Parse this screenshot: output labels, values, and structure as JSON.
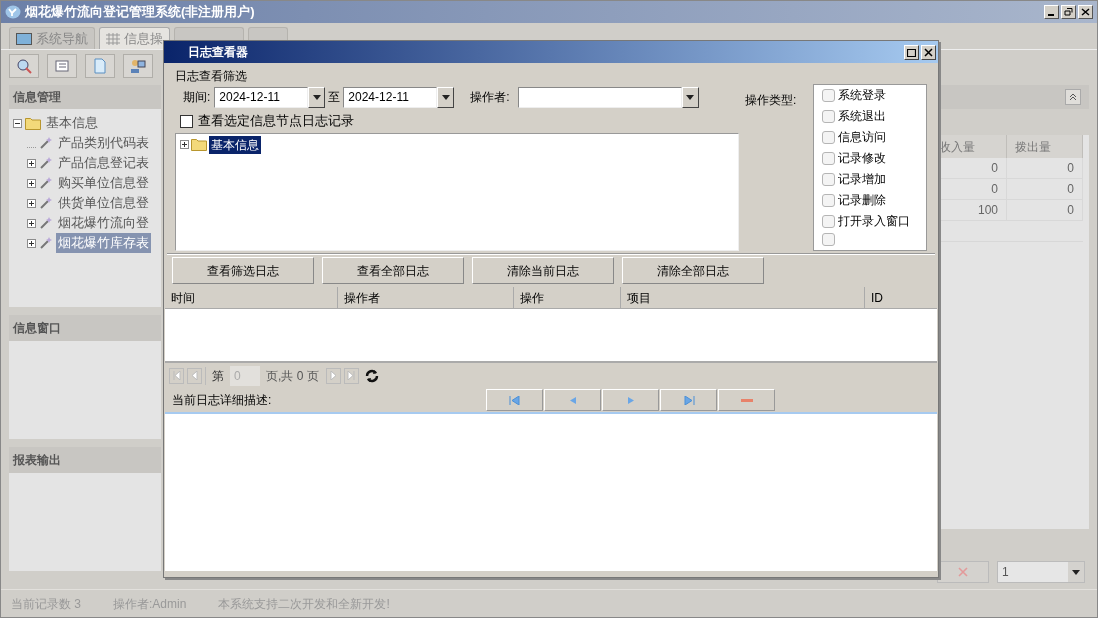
{
  "window": {
    "title": "烟花爆竹流向登记管理系统(非注册用户)"
  },
  "tabs": [
    {
      "label": "系统导航",
      "selected": false
    },
    {
      "label": "信息操",
      "selected": true
    }
  ],
  "left_panels": [
    {
      "title": "信息管理"
    },
    {
      "title": "信息窗口"
    },
    {
      "title": "报表输出"
    }
  ],
  "tree": [
    {
      "label": "基本信息",
      "expanded": true,
      "selected": false,
      "children": [
        {
          "label": "产品类别代码表",
          "leaf": true,
          "selected": false
        },
        {
          "label": "产品信息登记表",
          "leaf": false,
          "selected": false
        },
        {
          "label": "购买单位信息登",
          "leaf": false,
          "selected": false
        },
        {
          "label": "供货单位信息登",
          "leaf": false,
          "selected": false
        },
        {
          "label": "烟花爆竹流向登",
          "leaf": false,
          "selected": false
        },
        {
          "label": "烟花爆竹库存表",
          "leaf": false,
          "selected": true
        }
      ]
    }
  ],
  "grid": {
    "columns": [
      "收入量",
      "拨出量"
    ],
    "rows": [
      [
        "0",
        "0"
      ],
      [
        "0",
        "0"
      ],
      [
        "100",
        "0"
      ]
    ]
  },
  "page_size": "1",
  "status_bar": [
    "当前记录数 3",
    "操作者:Admin",
    "本系统支持二次开发和全新开发!"
  ],
  "dialog": {
    "title": "日志查看器",
    "filter_label": "日志查看筛选",
    "period_label": "期间:",
    "date_from": "2024-12-11",
    "to_label": "至",
    "date_to": "2024-12-11",
    "operator_label": "操作者:",
    "op_type_label": "操作类型:",
    "op_types": [
      {
        "label": "系统登录",
        "checked": false
      },
      {
        "label": "系统退出",
        "checked": false
      },
      {
        "label": "信息访问",
        "checked": false
      },
      {
        "label": "记录修改",
        "checked": false
      },
      {
        "label": "记录增加",
        "checked": false
      },
      {
        "label": "记录删除",
        "checked": false
      },
      {
        "label": "打开录入窗口",
        "checked": false
      }
    ],
    "cut_op_type": {
      "checked": false
    },
    "node_filter": {
      "label": "查看选定信息节点日志记录",
      "checked": false
    },
    "tree": [
      {
        "label": "基本信息",
        "selected": true
      }
    ],
    "buttons": [
      "查看筛选日志",
      "查看全部日志",
      "清除当前日志",
      "清除全部日志"
    ],
    "columns": [
      "时间",
      "操作者",
      "操作",
      "项目",
      "ID"
    ],
    "pager": {
      "page_label": "第",
      "page": "0",
      "total": "页,共 0 页"
    },
    "detail_label": "当前日志详细描述:"
  }
}
